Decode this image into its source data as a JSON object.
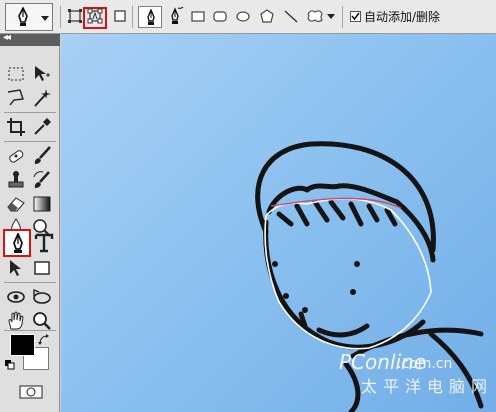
{
  "options_bar": {
    "auto_add_delete_label": "自动添加/删除",
    "auto_add_delete_checked": true,
    "active_tool_icon": "pen-icon",
    "mode_icons": [
      "shape-layers-icon",
      "paths-icon",
      "fill-pixels-icon"
    ],
    "selected_mode": "paths-icon",
    "drawing_icons": [
      "pen-icon",
      "freeform-pen-icon",
      "rectangle-icon",
      "rounded-rectangle-icon",
      "ellipse-icon",
      "polygon-icon",
      "line-icon",
      "custom-shape-icon"
    ]
  },
  "toolbox": {
    "header_icon": "collapse-arrows-icon",
    "selected_tool": "pen-icon",
    "foreground_color": "#000000",
    "background_color": "#ffffff"
  },
  "canvas": {
    "watermark_brand": "PConline",
    "watermark_domain": ".com.cn",
    "watermark_cn": "太平洋电脑网",
    "background_color": "#8dc2f0",
    "highlight_color": "#e01010"
  }
}
